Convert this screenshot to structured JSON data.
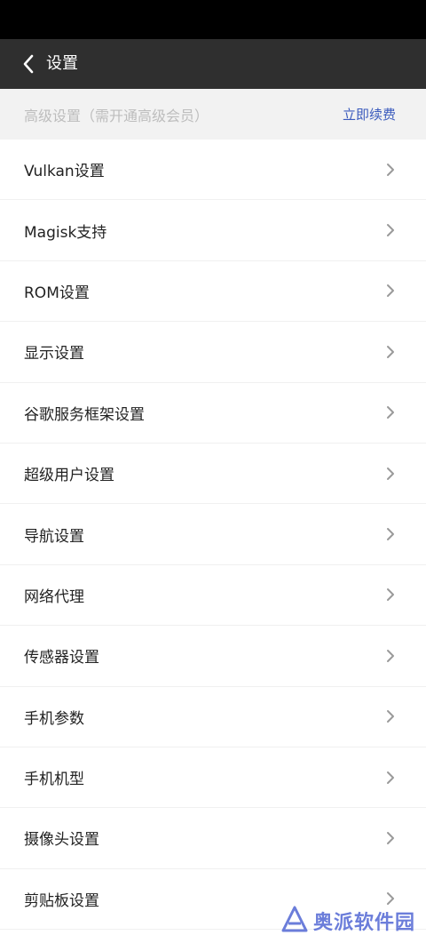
{
  "app_bar": {
    "title": "设置",
    "back_icon": "back-chevron-icon"
  },
  "premium": {
    "label": "高级设置（需开通高级会员）",
    "renew_label": "立即续费"
  },
  "settings": {
    "items": [
      {
        "label": "Vulkan设置"
      },
      {
        "label": "Magisk支持"
      },
      {
        "label": "ROM设置"
      },
      {
        "label": "显示设置"
      },
      {
        "label": "谷歌服务框架设置"
      },
      {
        "label": "超级用户设置"
      },
      {
        "label": "导航设置"
      },
      {
        "label": "网络代理"
      },
      {
        "label": "传感器设置"
      },
      {
        "label": "手机参数"
      },
      {
        "label": "手机机型"
      },
      {
        "label": "摄像头设置"
      },
      {
        "label": "剪贴板设置"
      }
    ]
  },
  "watermark": {
    "text": "奥派软件园"
  },
  "colors": {
    "status_bar": "#000000",
    "app_bar": "#2f2f2f",
    "premium_bg": "#f2f2f2",
    "accent": "#3b5bbd"
  }
}
